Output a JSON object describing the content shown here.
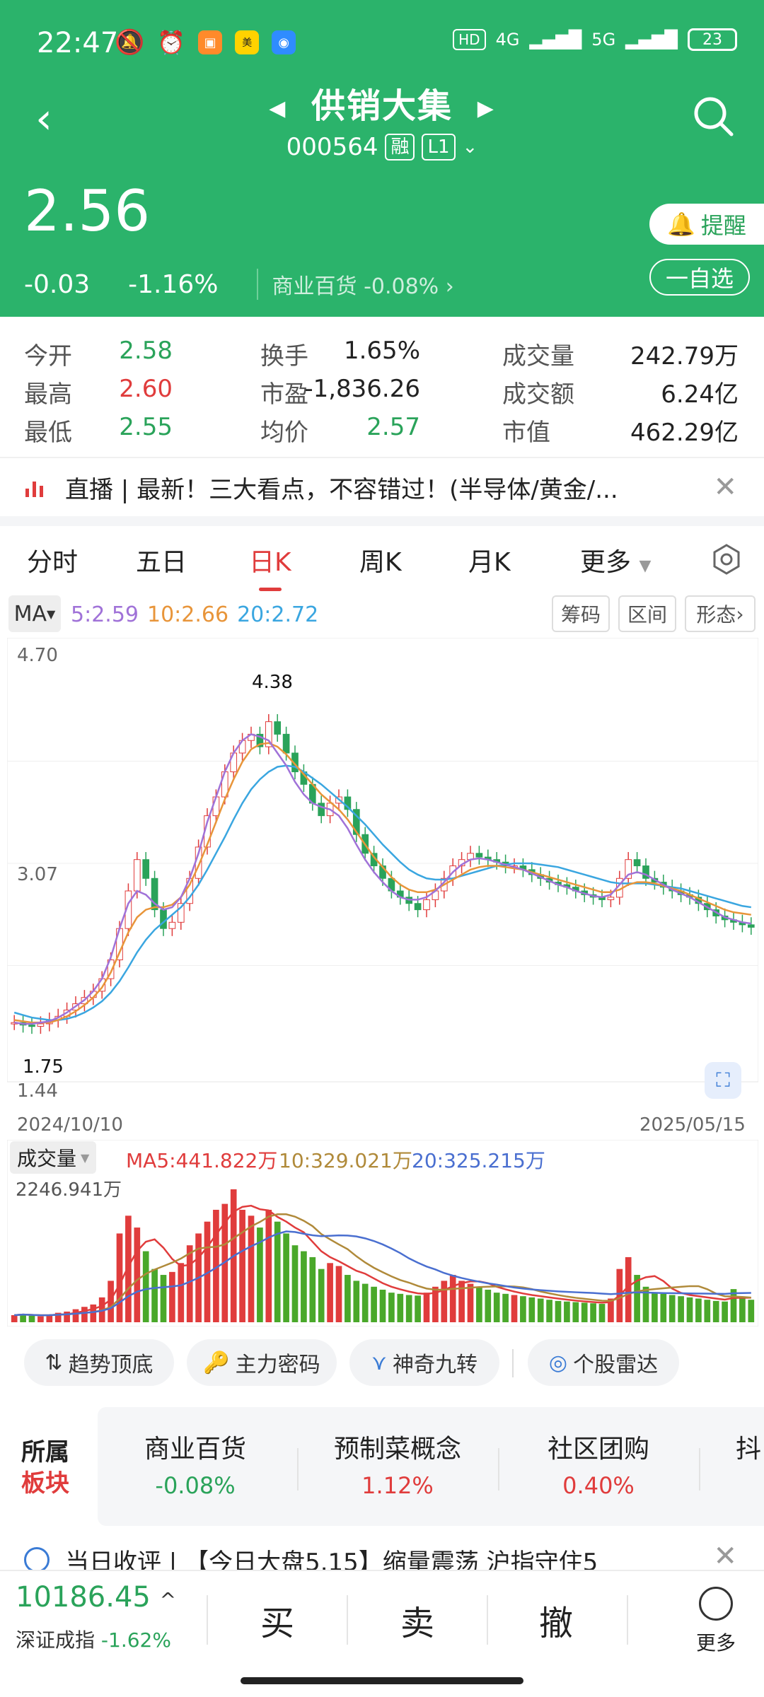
{
  "status": {
    "time": "22:47",
    "network1": "4G",
    "network2": "5G",
    "battery": "23",
    "hd": "HD"
  },
  "header": {
    "stock_name": "供销大集",
    "code": "000564",
    "tag_margin": "融",
    "tag_level": "L1",
    "price": "2.56",
    "change": "-0.03",
    "change_pct": "-1.16%",
    "sector": "商业百货",
    "sector_pct": "-0.08%",
    "remind_label": "提醒",
    "watch_label": "一自选"
  },
  "quote": {
    "rows": [
      [
        {
          "l": "今开",
          "v": "2.58",
          "c": "green"
        },
        {
          "l": "换手",
          "v": "1.65%",
          "c": "plain"
        },
        {
          "l": "成交量",
          "v": "242.79万",
          "c": "plain"
        }
      ],
      [
        {
          "l": "最高",
          "v": "2.60",
          "c": "red"
        },
        {
          "l": "市盈",
          "v": "-1,836.26",
          "c": "plain"
        },
        {
          "l": "成交额",
          "v": "6.24亿",
          "c": "plain"
        }
      ],
      [
        {
          "l": "最低",
          "v": "2.55",
          "c": "green"
        },
        {
          "l": "均价",
          "v": "2.57",
          "c": "green"
        },
        {
          "l": "市值",
          "v": "462.29亿",
          "c": "plain"
        }
      ]
    ]
  },
  "news_top": "直播 | 最新！三大看点，不容错过！(半导体/黄金/...",
  "tabs": [
    "分时",
    "五日",
    "日K",
    "周K",
    "月K",
    "更多"
  ],
  "active_tab": 2,
  "ma": {
    "selector": "MA",
    "ma5": "5:2.59",
    "ma10": "10:2.66",
    "ma20": "20:2.72",
    "buttons": [
      "筹码",
      "区间",
      "形态"
    ]
  },
  "chart_labels": {
    "y_top": "4.70",
    "y_mid": "3.07",
    "y_bot": "1.44",
    "high_mark": "4.38",
    "low_mark": "1.75",
    "start_date": "2024/10/10",
    "end_date": "2025/05/15"
  },
  "volume": {
    "selector": "成交量",
    "ma5": "MA5:441.822万",
    "ma10": "10:329.021万",
    "ma20": "20:325.215万",
    "max_label": "2246.941万"
  },
  "indicators": [
    "趋势顶底",
    "主力密码",
    "神奇九转",
    "个股雷达"
  ],
  "sector_block": {
    "label1": "所属",
    "label2": "板块",
    "items": [
      {
        "name": "商业百货",
        "pct": "-0.08%",
        "c": "green"
      },
      {
        "name": "预制菜概念",
        "pct": "1.12%",
        "c": "red"
      },
      {
        "name": "社区团购",
        "pct": "0.40%",
        "c": "red"
      },
      {
        "name": "抖",
        "pct": "",
        "c": "red"
      }
    ]
  },
  "news_bottom": "当日收评 | 【今日大盘5.15】缩量震荡 沪指守住5",
  "bottom": {
    "index_value": "10186.45",
    "index_name": "深证成指",
    "index_pct": "-1.62%",
    "buy": "买",
    "sell": "卖",
    "cancel": "撤",
    "more": "更多"
  },
  "chart_data": {
    "type": "candlestick",
    "x_range": [
      "2024/10/10",
      "2025/05/15"
    ],
    "ylim": [
      1.44,
      4.7
    ],
    "closes": [
      1.8,
      1.78,
      1.77,
      1.79,
      1.82,
      1.85,
      1.9,
      1.95,
      2.0,
      2.05,
      2.15,
      2.3,
      2.55,
      2.85,
      3.1,
      2.95,
      2.7,
      2.55,
      2.6,
      2.75,
      2.95,
      3.2,
      3.45,
      3.6,
      3.8,
      3.95,
      4.05,
      4.1,
      4.0,
      4.2,
      4.1,
      3.95,
      3.8,
      3.7,
      3.55,
      3.45,
      3.55,
      3.6,
      3.5,
      3.3,
      3.15,
      3.05,
      2.95,
      2.85,
      2.8,
      2.75,
      2.7,
      2.78,
      2.85,
      2.95,
      3.05,
      3.1,
      3.15,
      3.12,
      3.1,
      3.08,
      3.05,
      3.05,
      3.02,
      2.98,
      2.95,
      2.92,
      2.9,
      2.88,
      2.85,
      2.82,
      2.8,
      2.78,
      2.8,
      2.95,
      3.1,
      3.05,
      2.95,
      2.92,
      2.88,
      2.85,
      2.82,
      2.8,
      2.75,
      2.7,
      2.65,
      2.62,
      2.6,
      2.58,
      2.56
    ],
    "ma5": [
      1.8,
      1.79,
      1.79,
      1.8,
      1.81,
      1.84,
      1.88,
      1.93,
      1.98,
      2.05,
      2.15,
      2.32,
      2.55,
      2.75,
      2.85,
      2.82,
      2.75,
      2.7,
      2.72,
      2.8,
      2.95,
      3.15,
      3.4,
      3.6,
      3.8,
      3.95,
      4.05,
      4.1,
      4.08,
      4.05,
      3.95,
      3.85,
      3.72,
      3.62,
      3.55,
      3.52,
      3.5,
      3.45,
      3.35,
      3.22,
      3.1,
      3.0,
      2.92,
      2.85,
      2.8,
      2.78,
      2.78,
      2.8,
      2.85,
      2.92,
      3.0,
      3.06,
      3.1,
      3.11,
      3.1,
      3.08,
      3.06,
      3.04,
      3.02,
      2.99,
      2.96,
      2.93,
      2.9,
      2.88,
      2.85,
      2.83,
      2.81,
      2.8,
      2.82,
      2.9,
      2.98,
      3.0,
      2.98,
      2.94,
      2.9,
      2.86,
      2.83,
      2.8,
      2.76,
      2.72,
      2.68,
      2.64,
      2.62,
      2.6,
      2.59
    ],
    "ma10": [
      1.82,
      1.81,
      1.8,
      1.8,
      1.8,
      1.82,
      1.85,
      1.89,
      1.94,
      2.0,
      2.08,
      2.2,
      2.36,
      2.52,
      2.64,
      2.7,
      2.72,
      2.72,
      2.74,
      2.8,
      2.9,
      3.05,
      3.22,
      3.4,
      3.58,
      3.74,
      3.88,
      3.98,
      4.02,
      4.03,
      4.0,
      3.94,
      3.86,
      3.78,
      3.7,
      3.62,
      3.56,
      3.5,
      3.42,
      3.32,
      3.22,
      3.12,
      3.04,
      2.96,
      2.9,
      2.86,
      2.84,
      2.84,
      2.86,
      2.9,
      2.94,
      2.98,
      3.02,
      3.04,
      3.05,
      3.05,
      3.04,
      3.03,
      3.02,
      3.0,
      2.98,
      2.96,
      2.94,
      2.92,
      2.9,
      2.88,
      2.86,
      2.84,
      2.84,
      2.86,
      2.9,
      2.92,
      2.92,
      2.91,
      2.89,
      2.87,
      2.85,
      2.82,
      2.79,
      2.76,
      2.73,
      2.7,
      2.68,
      2.67,
      2.66
    ],
    "ma20": [
      1.88,
      1.86,
      1.84,
      1.83,
      1.82,
      1.82,
      1.83,
      1.85,
      1.88,
      1.92,
      1.97,
      2.04,
      2.13,
      2.24,
      2.36,
      2.46,
      2.54,
      2.6,
      2.66,
      2.72,
      2.8,
      2.9,
      3.02,
      3.15,
      3.28,
      3.42,
      3.55,
      3.66,
      3.74,
      3.8,
      3.84,
      3.85,
      3.84,
      3.8,
      3.75,
      3.7,
      3.64,
      3.58,
      3.52,
      3.45,
      3.38,
      3.3,
      3.22,
      3.15,
      3.08,
      3.02,
      2.98,
      2.95,
      2.94,
      2.94,
      2.95,
      2.97,
      2.99,
      3.01,
      3.03,
      3.05,
      3.06,
      3.07,
      3.07,
      3.07,
      3.06,
      3.05,
      3.04,
      3.02,
      3.0,
      2.98,
      2.96,
      2.94,
      2.92,
      2.91,
      2.91,
      2.91,
      2.91,
      2.9,
      2.89,
      2.88,
      2.87,
      2.85,
      2.83,
      2.81,
      2.79,
      2.77,
      2.75,
      2.73,
      2.72
    ],
    "volumes": [
      120,
      140,
      110,
      100,
      130,
      160,
      180,
      220,
      260,
      300,
      420,
      700,
      1500,
      1800,
      1600,
      1200,
      900,
      800,
      850,
      1000,
      1300,
      1500,
      1700,
      1900,
      2000,
      2246,
      1900,
      1800,
      1600,
      1900,
      1700,
      1500,
      1300,
      1200,
      1100,
      900,
      1000,
      950,
      800,
      700,
      650,
      600,
      550,
      500,
      480,
      460,
      450,
      500,
      600,
      700,
      800,
      700,
      650,
      600,
      550,
      500,
      480,
      460,
      440,
      420,
      400,
      380,
      360,
      350,
      340,
      330,
      320,
      310,
      400,
      900,
      1100,
      800,
      600,
      500,
      480,
      460,
      440,
      420,
      400,
      380,
      360,
      350,
      560,
      420,
      380
    ]
  }
}
